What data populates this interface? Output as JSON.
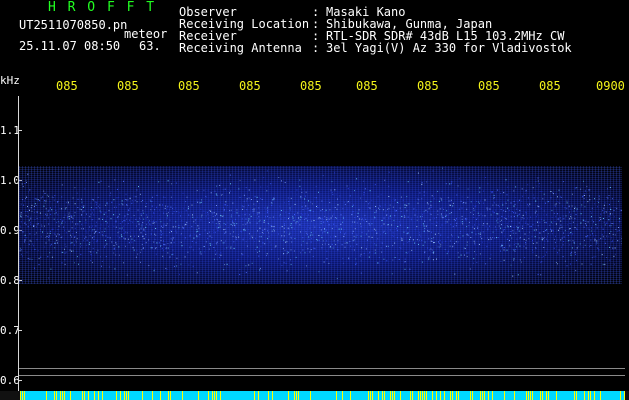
{
  "header": {
    "brand": "H R O F F T",
    "filename": "UT2511070850.pn",
    "datetime": "25.11.07 08:50",
    "meteor_label": "meteor",
    "meteor_count": "63."
  },
  "meta": [
    {
      "key": "Observer",
      "value": "Masaki Kano"
    },
    {
      "key": "Receiving Location",
      "value": "Shibukawa, Gunma, Japan"
    },
    {
      "key": "Receiver",
      "value": "RTL-SDR SDR# 43dB L15 103.2MHz CW"
    },
    {
      "key": "Receiving Antenna",
      "value": "3el Yagi(V) Az 330 for Vladivostok"
    }
  ],
  "meta_colon": ":",
  "axis": {
    "y_unit": "kHz",
    "y_ticks": [
      "1.1",
      "1.0",
      "0.9",
      "0.8",
      "0.7",
      "0.6"
    ],
    "x_ticks": [
      "085",
      "085",
      "085",
      "085",
      "085",
      "085",
      "085",
      "085",
      "085",
      "0900"
    ]
  },
  "colors": {
    "brand": "#22ff22",
    "time_labels": "#f4f41a",
    "signal": "#2a48ff",
    "footer_cyan": "#00d8ff",
    "footer_yellow": "#ffff00"
  }
}
